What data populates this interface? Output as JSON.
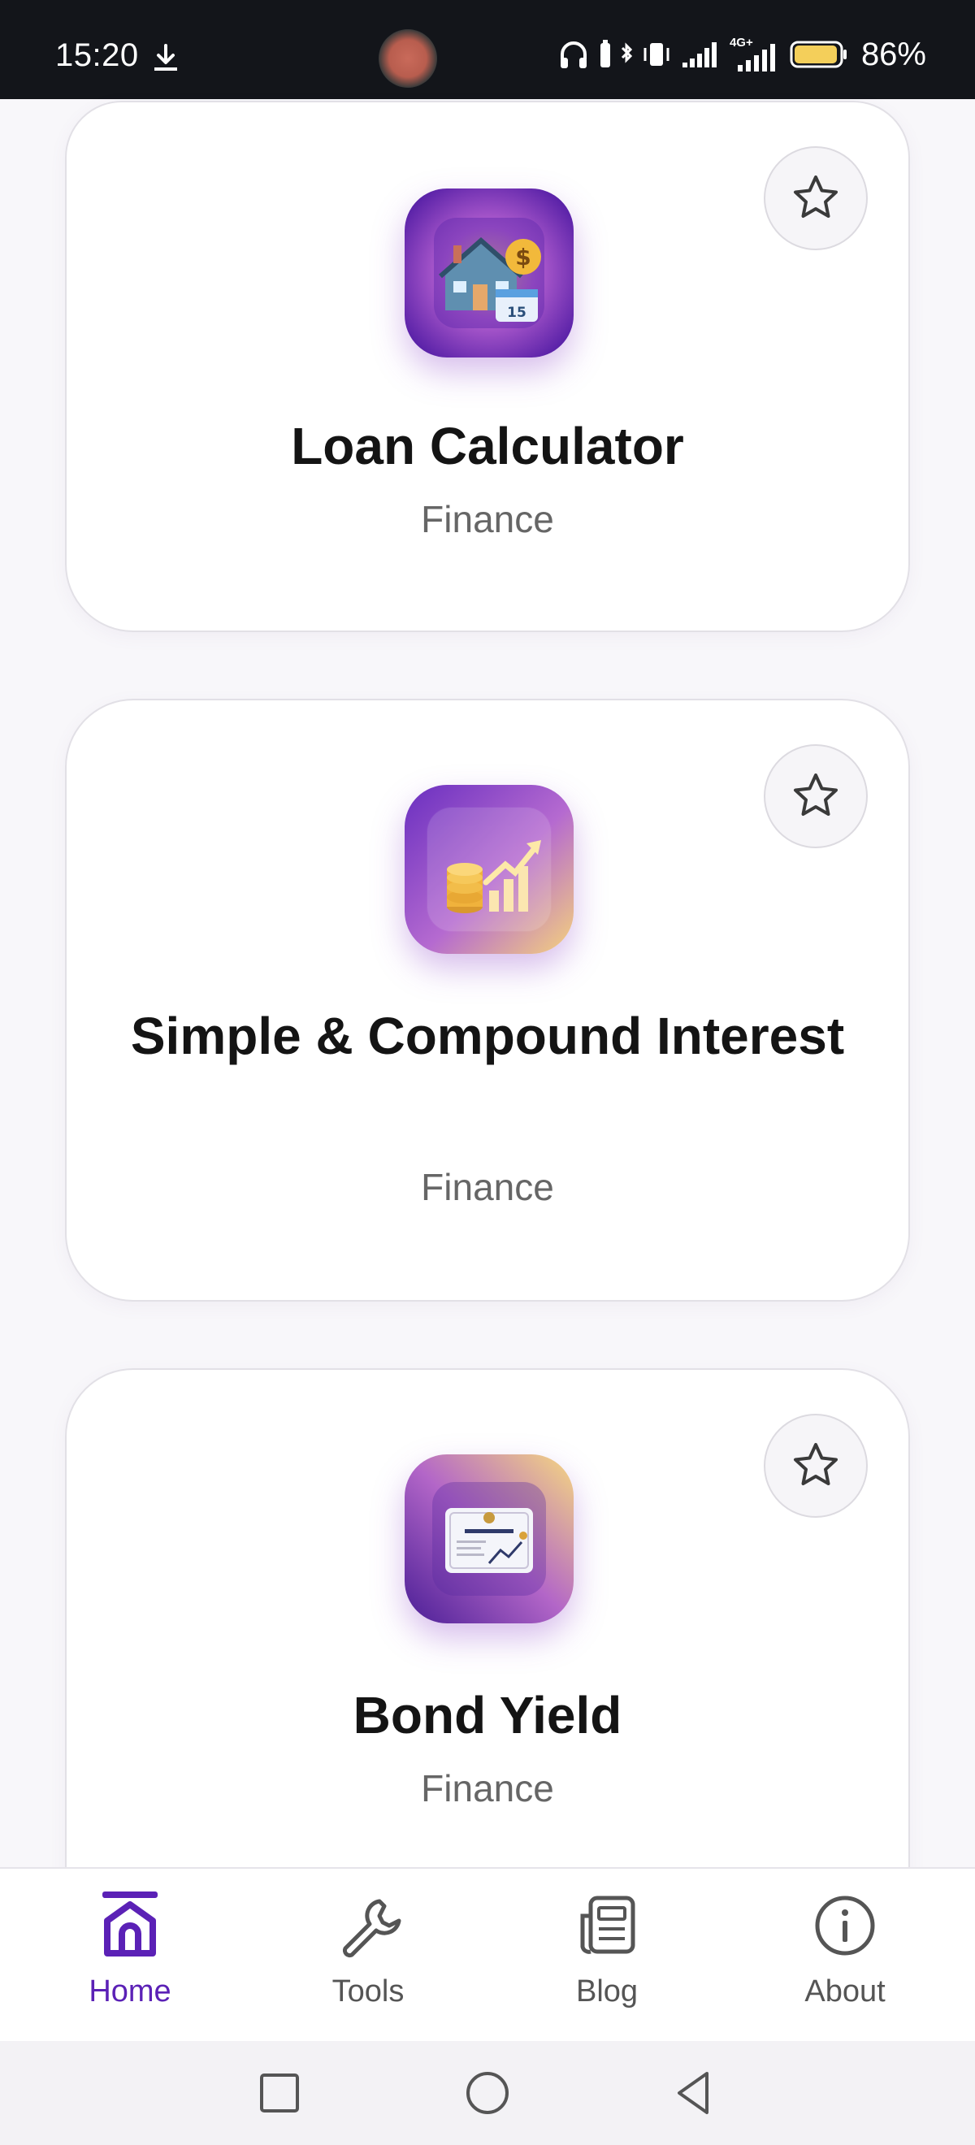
{
  "status_bar": {
    "time": "15:20",
    "battery_percent": "86%",
    "network": "4G+",
    "icons": [
      "download-icon",
      "headphones-icon",
      "bluetooth-icon",
      "vibrate-icon",
      "signal-icon",
      "signal-4g-icon",
      "battery-icon"
    ]
  },
  "cards": [
    {
      "title": "Loan Calculator",
      "category": "Finance",
      "icon": "house-loan-icon",
      "favorited": false
    },
    {
      "title": "Simple & Compound Interest",
      "category": "Finance",
      "icon": "coins-growth-icon",
      "favorited": false
    },
    {
      "title": "Bond Yield",
      "category": "Finance",
      "icon": "bond-certificate-icon",
      "favorited": false
    }
  ],
  "bottom_nav": {
    "items": [
      {
        "label": "Home",
        "icon": "home-icon",
        "active": true
      },
      {
        "label": "Tools",
        "icon": "wrench-icon",
        "active": false
      },
      {
        "label": "Blog",
        "icon": "newspaper-icon",
        "active": false
      },
      {
        "label": "About",
        "icon": "info-icon",
        "active": false
      }
    ]
  },
  "colors": {
    "accent": "#5b21b6",
    "status_bar_bg": "#13151a",
    "card_bg": "#ffffff",
    "page_bg": "#f8f7fa",
    "title_text": "#141414",
    "sub_text": "#666666"
  }
}
